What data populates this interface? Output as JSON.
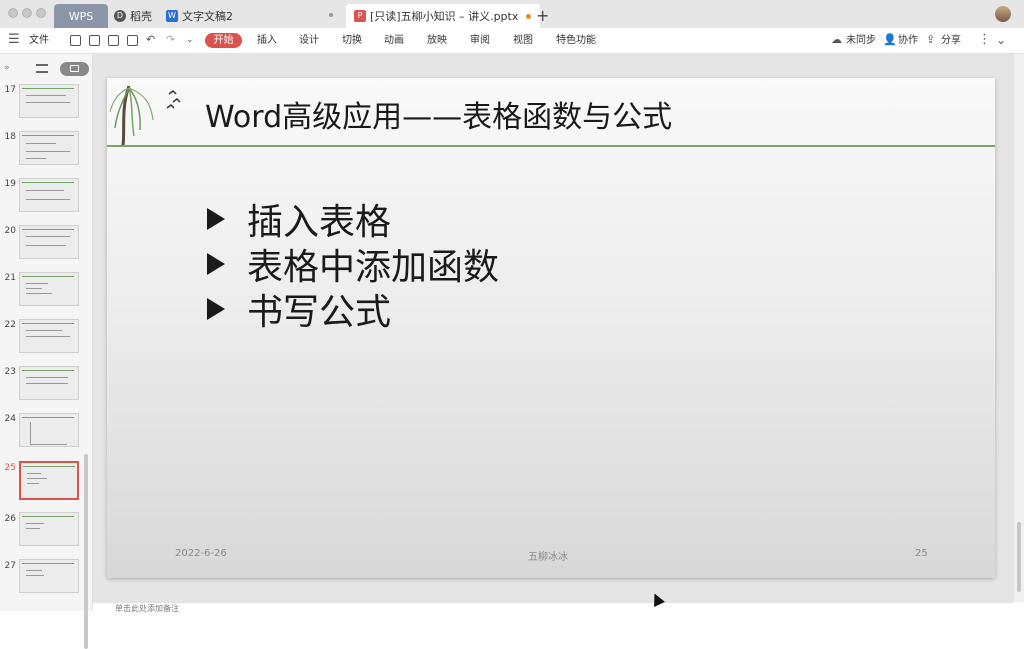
{
  "tabs": {
    "home": "WPS",
    "daoke": "稻壳",
    "doc": "文字文稿2",
    "ppt": "[只读]五柳小知识 – 讲义.pptx"
  },
  "toolbar": {
    "file": "文件",
    "menus": [
      "开始",
      "插入",
      "设计",
      "切换",
      "动画",
      "放映",
      "审阅",
      "视图",
      "特色功能"
    ],
    "sync": "未同步",
    "collab": "协作",
    "share": "分享"
  },
  "thumbnails": {
    "numbers": [
      "17",
      "18",
      "19",
      "20",
      "21",
      "22",
      "23",
      "24",
      "25",
      "26",
      "27"
    ],
    "active": "25"
  },
  "slide": {
    "title": "Word高级应用——表格函数与公式",
    "bullets": [
      "插入表格",
      "表格中添加函数",
      "书写公式"
    ],
    "date": "2022-6-26",
    "author": "五柳冰冰",
    "page": "25"
  },
  "notes": {
    "placeholder": "单击此处添加备注"
  },
  "colors": {
    "accent": "#d9534f",
    "rule": "#7aa36a",
    "tab_active": "#8a96a8"
  }
}
